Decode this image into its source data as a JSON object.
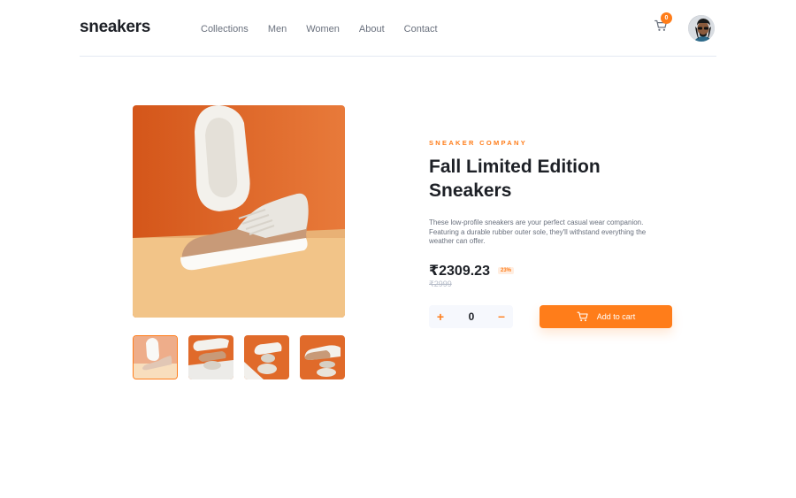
{
  "header": {
    "logo": "sneakers",
    "nav": [
      "Collections",
      "Men",
      "Women",
      "About",
      "Contact"
    ],
    "cart_count": "0"
  },
  "product": {
    "company": "SNEAKER COMPANY",
    "title": "Fall Limited Edition Sneakers",
    "description": "These low-profile sneakers are your perfect casual wear companion. Featuring a durable rubber outer sole, they'll withstand everything the weather can offer.",
    "price": "₹2309.23",
    "discount": "23%",
    "old_price": "₹2999",
    "quantity": "0",
    "add_to_cart": "Add to cart"
  },
  "colors": {
    "accent": "#ff7d1a",
    "accent_light": "#ffede0",
    "text_dark": "#1d2026",
    "text_muted": "#69707d",
    "qty_bg": "#f6f8fd"
  },
  "icons": {
    "cart": "cart-icon",
    "plus": "plus-icon",
    "minus": "minus-icon",
    "avatar": "avatar"
  }
}
